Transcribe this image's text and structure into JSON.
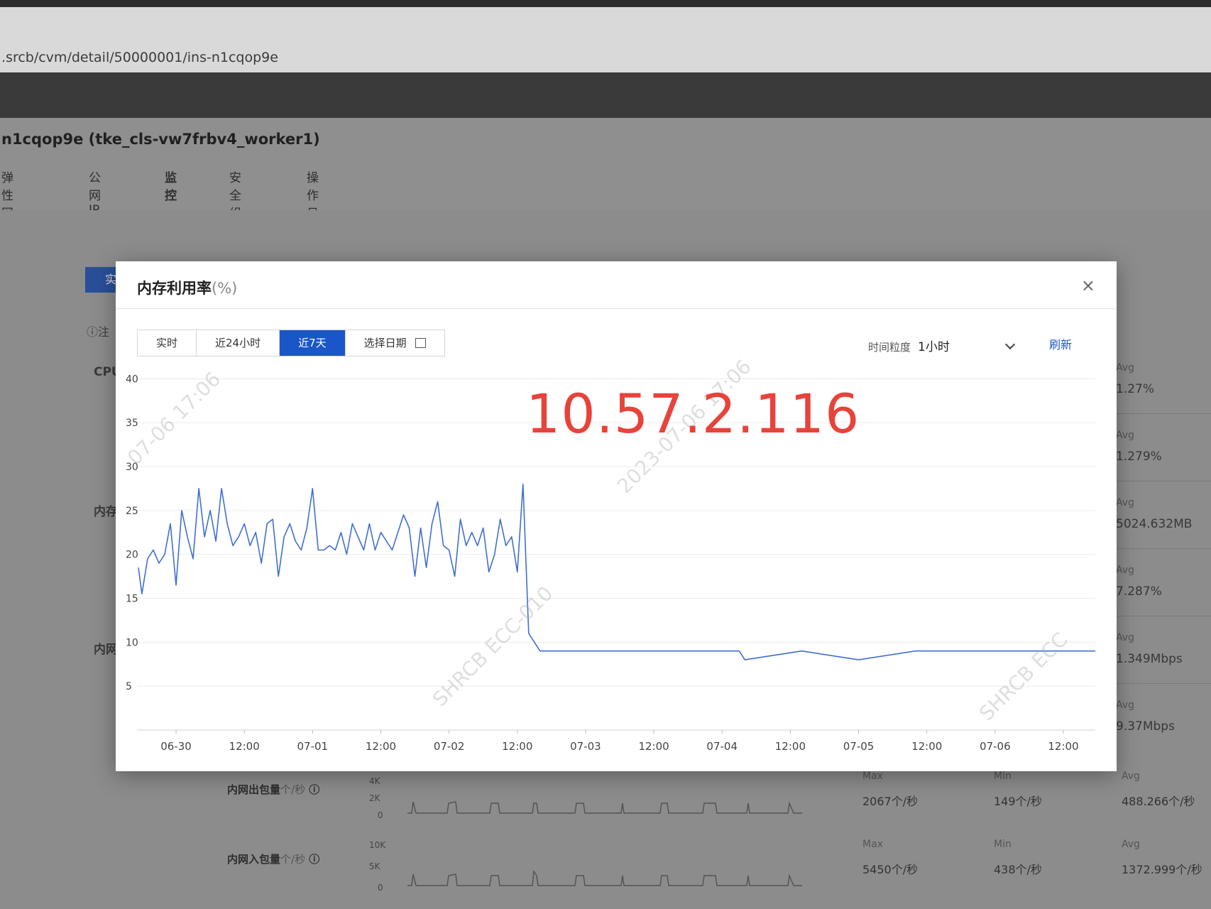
{
  "browser": {
    "url": ".srcb/cvm/detail/50000001/ins-n1cqop9e"
  },
  "instance": {
    "title": "n1cqop9e (tke_cls-vw7frbv4_worker1)",
    "tabs": [
      {
        "label": "弹性网卡"
      },
      {
        "label": "公网IP"
      },
      {
        "label": "监控",
        "active": true
      },
      {
        "label": "安全组"
      },
      {
        "label": "操作日志"
      }
    ]
  },
  "background": {
    "blue_button": "实",
    "note": "ⓘ注",
    "labels": [
      "CPU",
      "内存",
      "内网"
    ],
    "right_stats": [
      {
        "k": "Avg",
        "v": "1.27%"
      },
      {
        "k": "Avg",
        "v": "1.279%"
      },
      {
        "k": "Avg",
        "v": "5024.632MB"
      },
      {
        "k": "Avg",
        "v": "7.287%"
      },
      {
        "k": "Avg",
        "v": "1.349Mbps"
      },
      {
        "k": "Avg",
        "v": "9.37Mbps"
      }
    ],
    "bottom_rows": [
      {
        "label": "内网出包量",
        "unit": "个/秒",
        "axis": [
          "4K",
          "2K",
          "0"
        ],
        "max": "2067个/秒",
        "min": "149个/秒",
        "avg": "488.266个/秒"
      },
      {
        "label": "内网入包量",
        "unit": "个/秒",
        "axis": [
          "10K",
          "5K",
          "0"
        ],
        "max": "5450个/秒",
        "min": "438个/秒",
        "avg": "1372.999个/秒"
      }
    ],
    "stat_keys": {
      "max": "Max",
      "min": "Min",
      "avg": "Avg"
    }
  },
  "modal": {
    "title": "内存利用率",
    "unit": "(%)",
    "close": "×",
    "ranges": [
      "实时",
      "近24小时",
      "近7天",
      "选择日期"
    ],
    "active_range": "近7天",
    "granularity_label": "时间粒度",
    "granularity_value": "1小时",
    "refresh": "刷新",
    "overlay_text": "10.57.2.116",
    "watermarks": [
      "07-06 17:06",
      "2023-07-06 17:06",
      "SHRCB ECC-010",
      "SHRCB ECC"
    ]
  },
  "chart_data": {
    "type": "line",
    "title": "内存利用率(%)",
    "xlabel": "",
    "ylabel": "",
    "ylim": [
      0,
      40
    ],
    "yticks": [
      5,
      10,
      15,
      20,
      25,
      30,
      35,
      40
    ],
    "xlim": [
      0,
      168
    ],
    "xticks": [
      {
        "t": 0,
        "label": "06-30"
      },
      {
        "t": 12,
        "label": "12:00"
      },
      {
        "t": 24,
        "label": "07-01"
      },
      {
        "t": 36,
        "label": "12:00"
      },
      {
        "t": 48,
        "label": "07-02"
      },
      {
        "t": 60,
        "label": "12:00"
      },
      {
        "t": 72,
        "label": "07-03"
      },
      {
        "t": 84,
        "label": "12:00"
      },
      {
        "t": 96,
        "label": "07-04"
      },
      {
        "t": 108,
        "label": "12:00"
      },
      {
        "t": 120,
        "label": "07-05"
      },
      {
        "t": 132,
        "label": "12:00"
      },
      {
        "t": 144,
        "label": "07-06"
      },
      {
        "t": 156,
        "label": "12:00"
      }
    ],
    "grid": true,
    "series": [
      {
        "color": "#3f6fd0",
        "t": [
          -7,
          -6,
          -5,
          -4,
          -3,
          -2,
          -1,
          0,
          1,
          2,
          3,
          4,
          5,
          6,
          7,
          8,
          9,
          10,
          11,
          12,
          13,
          14,
          15,
          16,
          17,
          18,
          19,
          20,
          21,
          22,
          23,
          24,
          25,
          26,
          27,
          28,
          29,
          30,
          31,
          32,
          33,
          34,
          35,
          36,
          37,
          38,
          39,
          40,
          41,
          42,
          43,
          44,
          45,
          46,
          47,
          48,
          49,
          50,
          51,
          52,
          53,
          54,
          55,
          56,
          57,
          58,
          59,
          60,
          61,
          62,
          63,
          64,
          65,
          66,
          67,
          68,
          69,
          70,
          71,
          72,
          73,
          74,
          75,
          76,
          77,
          78,
          79,
          80,
          81,
          82,
          83,
          84,
          85,
          86,
          87,
          88,
          89,
          90,
          91,
          92,
          93,
          94,
          95,
          96,
          97,
          98,
          99,
          100,
          110,
          120,
          130,
          140,
          150,
          160,
          164,
          165
        ],
        "y": [
          18.5,
          15.5,
          19.5,
          20.5,
          19,
          20,
          23.5,
          16.5,
          25,
          22,
          19.5,
          27.5,
          22,
          25,
          21.5,
          27.5,
          23.5,
          21,
          22,
          23.5,
          21,
          22.5,
          19,
          23.5,
          24,
          17.5,
          22,
          23.5,
          21.5,
          20.5,
          23,
          27.5,
          20.5,
          20.5,
          21,
          20.5,
          22.5,
          20,
          23.5,
          22,
          20.5,
          23.5,
          20.5,
          22.5,
          21.5,
          20.5,
          22.5,
          24.5,
          23,
          17.5,
          23,
          18.5,
          23.5,
          26,
          21,
          20.5,
          17.5,
          24,
          21,
          22.5,
          21,
          23,
          18,
          20,
          24,
          21,
          22,
          18,
          28,
          11,
          10,
          9,
          9,
          9,
          9,
          9,
          9,
          9,
          9,
          9,
          9,
          9,
          9,
          9,
          9,
          9,
          9,
          9,
          9,
          9,
          9,
          9,
          9,
          9,
          9,
          9,
          9,
          9,
          9,
          9,
          9,
          9,
          9,
          9,
          9,
          9,
          9,
          8,
          9,
          8,
          9,
          9,
          9,
          9,
          9,
          9,
          9,
          8
        ]
      }
    ]
  }
}
